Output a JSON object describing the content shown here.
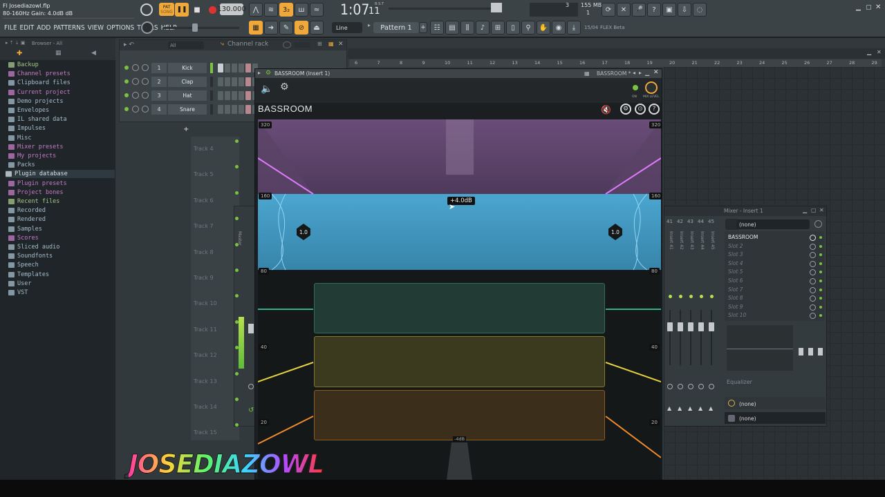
{
  "window": {
    "title": "Fl Josediazowl.flp",
    "hint": "80-160Hz Gain: 4.0dB dB"
  },
  "transport": {
    "pat_label": "PAT",
    "song_label": "SONG",
    "tempo": "130.000",
    "time_main": "1:07",
    "time_sub": "11",
    "time_bst": "B:S:T",
    "cpu_top": "3",
    "cpu_bot": "1",
    "mem": "155 MB"
  },
  "menu": [
    "FILE",
    "EDIT",
    "ADD",
    "PATTERNS",
    "VIEW",
    "OPTIONS",
    "TOOLS",
    "HELP"
  ],
  "toolbar2": {
    "snap": "Line",
    "pattern": "Pattern 1",
    "plus": "+",
    "news": "15/04",
    "news_text": "FLEX Beta"
  },
  "browser": {
    "header": "Browser - All",
    "items": [
      {
        "label": "Backup",
        "color": "#a7c78a"
      },
      {
        "label": "Channel presets",
        "color": "#c77cc7"
      },
      {
        "label": "Clipboard files",
        "color": "#a6bfcc"
      },
      {
        "label": "Current project",
        "color": "#c77cc7"
      },
      {
        "label": "Demo projects",
        "color": "#a6bfcc"
      },
      {
        "label": "Envelopes",
        "color": "#a6bfcc"
      },
      {
        "label": "IL shared data",
        "color": "#a6bfcc"
      },
      {
        "label": "Impulses",
        "color": "#a6bfcc"
      },
      {
        "label": "Misc",
        "color": "#a6bfcc"
      },
      {
        "label": "Mixer presets",
        "color": "#c77cc7"
      },
      {
        "label": "My projects",
        "color": "#c77cc7"
      },
      {
        "label": "Packs",
        "color": "#a6bfcc"
      },
      {
        "label": "Plugin database",
        "color": "#d9e2e6"
      },
      {
        "label": "Plugin presets",
        "color": "#c77cc7"
      },
      {
        "label": "Project bones",
        "color": "#c77cc7"
      },
      {
        "label": "Recent files",
        "color": "#a7c78a"
      },
      {
        "label": "Recorded",
        "color": "#a6bfcc"
      },
      {
        "label": "Rendered",
        "color": "#a6bfcc"
      },
      {
        "label": "Samples",
        "color": "#a6bfcc"
      },
      {
        "label": "Scores",
        "color": "#c77cc7"
      },
      {
        "label": "Sliced audio",
        "color": "#a6bfcc"
      },
      {
        "label": "Soundfonts",
        "color": "#a6bfcc"
      },
      {
        "label": "Speech",
        "color": "#a6bfcc"
      },
      {
        "label": "Templates",
        "color": "#a6bfcc"
      },
      {
        "label": "User",
        "color": "#a6bfcc"
      },
      {
        "label": "VST",
        "color": "#a6bfcc"
      }
    ]
  },
  "channel_rack": {
    "title": "Channel rack",
    "filter": "All",
    "add": "+",
    "channels": [
      {
        "num": "1",
        "name": "Kick"
      },
      {
        "num": "2",
        "name": "Clap"
      },
      {
        "num": "3",
        "name": "Hat"
      },
      {
        "num": "4",
        "name": "Snare"
      }
    ]
  },
  "playlist": {
    "ruler": [
      "6",
      "7",
      "8",
      "9",
      "10",
      "11",
      "12",
      "13",
      "14",
      "15",
      "16",
      "17",
      "18",
      "19",
      "20",
      "21",
      "22",
      "23",
      "24",
      "25",
      "26",
      "27",
      "28",
      "29"
    ],
    "tracks": [
      "Track 4",
      "Track 5",
      "Track 6",
      "Track 7",
      "Track 8",
      "Track 9",
      "Track 10",
      "Track 11",
      "Track 12",
      "Track 13",
      "Track 14",
      "Track 15"
    ]
  },
  "plugin": {
    "window_title": "BASSROOM (Insert 1)",
    "preset": "BASSROOM *",
    "name": "BASSROOM",
    "on_label": "ON",
    "mix_label": "MIX LEVEL",
    "freq_left": [
      "320",
      "160",
      "80",
      "40",
      "20"
    ],
    "freq_right": [
      "320",
      "160",
      "80",
      "40",
      "20"
    ],
    "gain_tooltip": "+4.0dB",
    "q_left": "1.0",
    "q_right": "1.0",
    "bottom_db": "-4dB"
  },
  "mixer": {
    "title": "Mixer - Insert 1",
    "inserts": [
      "41",
      "42",
      "43",
      "44",
      "45"
    ],
    "strip_labels": [
      "Insert 41",
      "Insert 42",
      "Insert 43",
      "Insert 44",
      "Insert 45"
    ],
    "input": "(none)",
    "slots": [
      "BASSROOM",
      "Slot 2",
      "Slot 3",
      "Slot 4",
      "Slot 5",
      "Slot 6",
      "Slot 7",
      "Slot 8",
      "Slot 9",
      "Slot 10"
    ],
    "eq_label": "Equalizer",
    "out1": "(none)",
    "out2": "(none)"
  },
  "watermark": "JOSEDIAZOWL"
}
